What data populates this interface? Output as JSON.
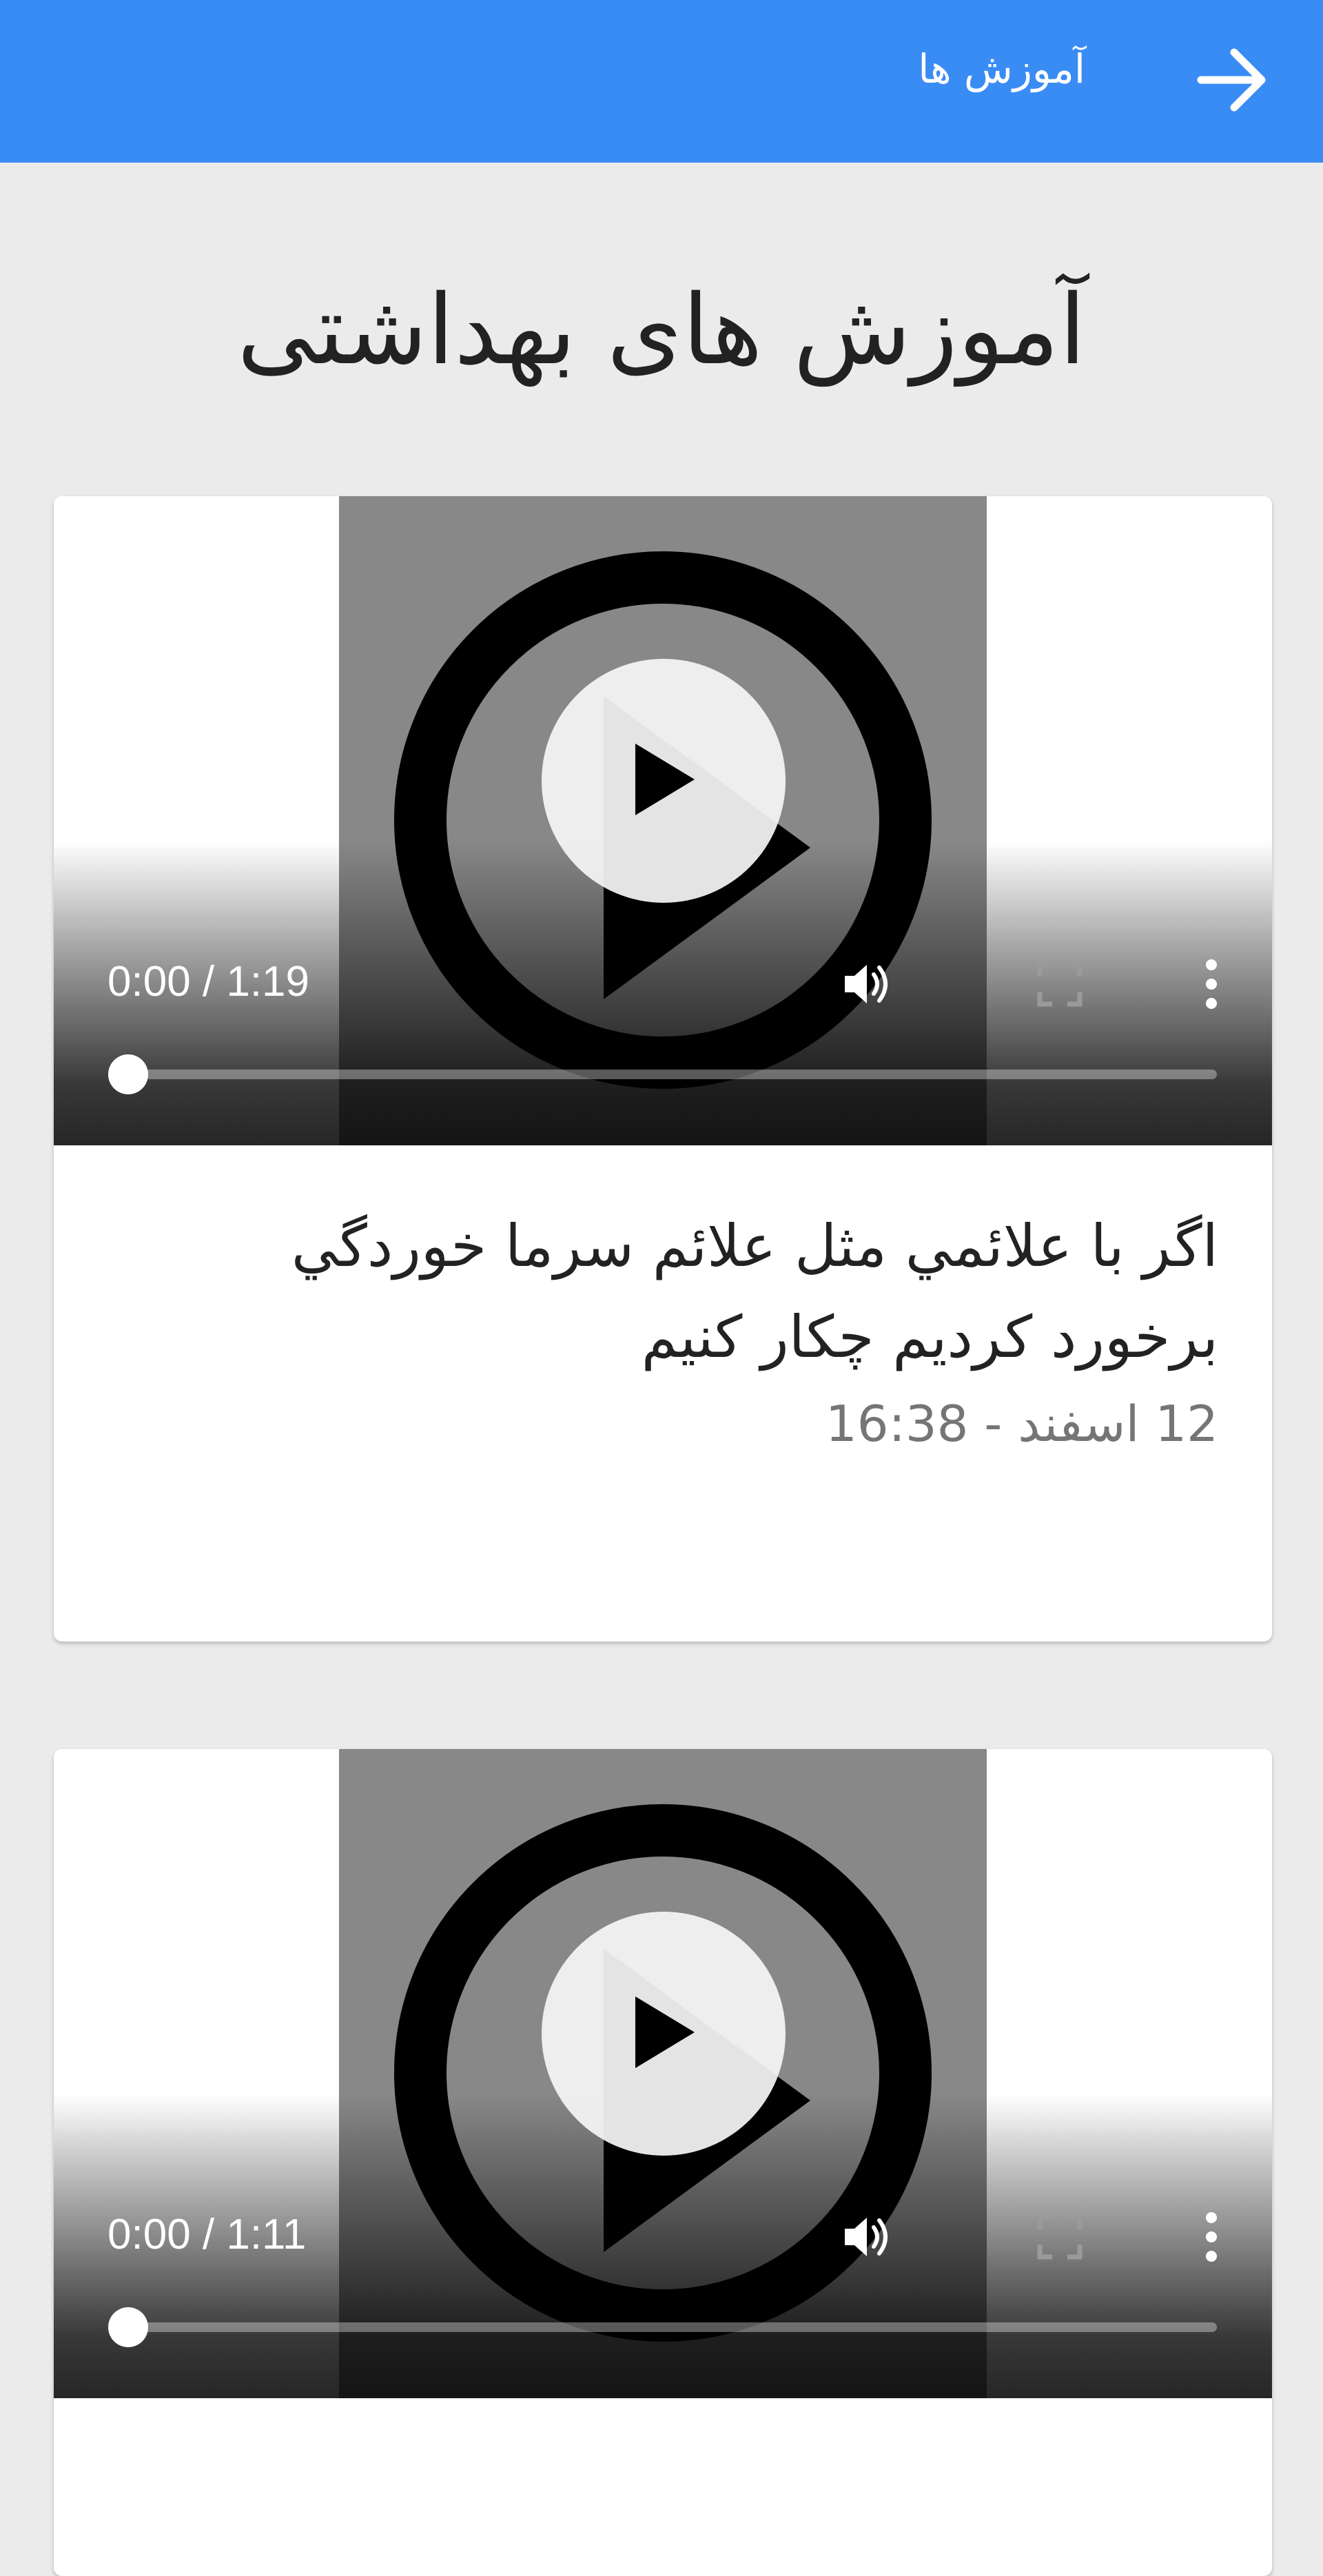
{
  "app_bar": {
    "title": "آموزش ها",
    "back_icon": "arrow-right-icon",
    "color": "#3a8cf5"
  },
  "page": {
    "title": "آموزش های بهداشتی"
  },
  "videos": [
    {
      "time": "0:00 / 1:19",
      "progress": 0,
      "title": "اگر با علائمي مثل علائم سرما خوردگي برخورد كرديم چكار كنيم",
      "date": "12 اسفند - 16:38"
    },
    {
      "time": "0:00 / 1:11",
      "progress": 0
    }
  ]
}
